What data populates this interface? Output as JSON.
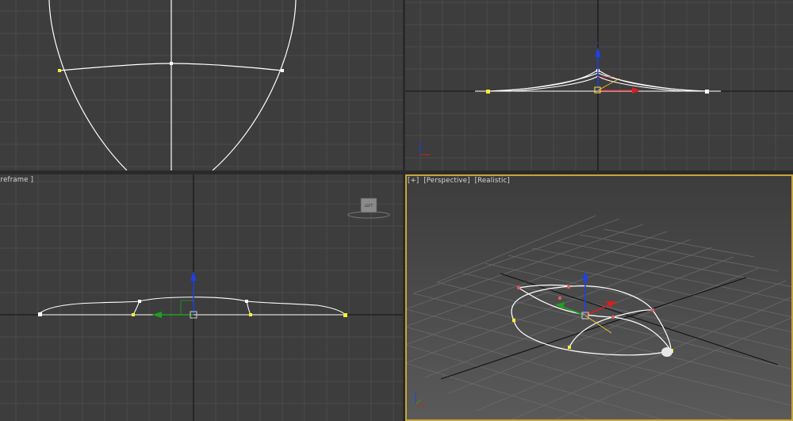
{
  "viewports": {
    "top": {
      "label_parts": []
    },
    "front": {
      "label_parts": []
    },
    "left": {
      "label_parts": [
        "ireframe ]"
      ],
      "viewcube_label": "LEFT"
    },
    "perspective": {
      "label_parts": [
        "[+]",
        "[Perspective]",
        "[Realistic]"
      ]
    }
  },
  "colors": {
    "viewport_bg": "#3d3d3d",
    "grid_line": "#4c4c4c",
    "axis_line": "#111111",
    "spline": "#ffffff",
    "vertex_yellow": "#ffee33",
    "vertex_white": "#ffffff",
    "vertex_red": "#e06060",
    "gizmo_x": "#d32020",
    "gizmo_y": "#20a020",
    "gizmo_z": "#2040e0",
    "active_border": "#c6a63a"
  },
  "icons": [
    "transform-gizmo-icon",
    "axis-tripod-icon",
    "viewcube-icon"
  ]
}
